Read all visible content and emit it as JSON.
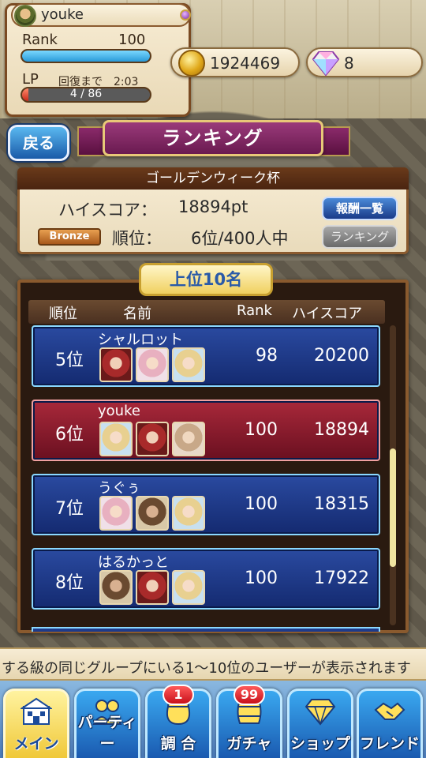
{
  "player": {
    "name": "youke",
    "rank_label": "Rank",
    "rank_value": "100",
    "rank_progress": 1.0,
    "lp_label": "LP",
    "lp_recover_text": "回復まで　2:03",
    "lp_text": "4 /  86",
    "lp_progress": 0.047
  },
  "currency": {
    "coins": "1924469",
    "coin_icon": "coin-icon",
    "gems": "8",
    "gem_icon": "diamond-icon"
  },
  "header": {
    "back_label": "戻る",
    "title": "ランキング"
  },
  "event": {
    "name": "ゴールデンウィーク杯",
    "highscore_label": "ハイスコア：",
    "highscore_value": "18894pt",
    "tier_badge": "Bronze",
    "position_label": "順位：",
    "position_value": "6位/400人中",
    "reward_button": "報酬一覧",
    "ranking_button": "ランキング"
  },
  "list": {
    "tab_label": "上位10名",
    "columns": [
      "順位",
      "名前",
      "Rank",
      "ハイスコア"
    ],
    "rows": [
      {
        "position": "5位",
        "name": "シャルロット",
        "rank": "98",
        "score": "20200",
        "highlight": false,
        "portraits": [
          "red",
          "pink",
          "blonde"
        ]
      },
      {
        "position": "6位",
        "name": "youke",
        "rank": "100",
        "score": "18894",
        "highlight": true,
        "portraits": [
          "blonde",
          "red",
          "tan"
        ]
      },
      {
        "position": "7位",
        "name": "うぐぅ",
        "rank": "100",
        "score": "18315",
        "highlight": false,
        "portraits": [
          "pink",
          "brown",
          "blonde"
        ]
      },
      {
        "position": "8位",
        "name": "はるかっと",
        "rank": "100",
        "score": "17922",
        "highlight": false,
        "portraits": [
          "brown",
          "red",
          "blonde"
        ]
      }
    ]
  },
  "ticker": {
    "text": "する級の同じグループにいる1〜10位のユーザーが表示されます"
  },
  "nav": {
    "items": [
      {
        "label": "メイン",
        "icon": "castle-icon",
        "active": true,
        "badge": ""
      },
      {
        "label": "パーティー",
        "icon": "party-icon",
        "active": false,
        "badge": ""
      },
      {
        "label": "調 合",
        "icon": "pot-icon",
        "active": false,
        "badge": "1"
      },
      {
        "label": "ガチャ",
        "icon": "barrel-icon",
        "active": false,
        "badge": "99"
      },
      {
        "label": "ショップ",
        "icon": "shop-diamond-icon",
        "active": false,
        "badge": ""
      },
      {
        "label": "フレンド",
        "icon": "handshake-icon",
        "active": false,
        "badge": ""
      }
    ]
  },
  "colors": {
    "row_normal": "#1e3a8a",
    "row_highlight": "#8a1c2c",
    "accent_gold": "#f0c838",
    "title_purple": "#7a2a62"
  }
}
